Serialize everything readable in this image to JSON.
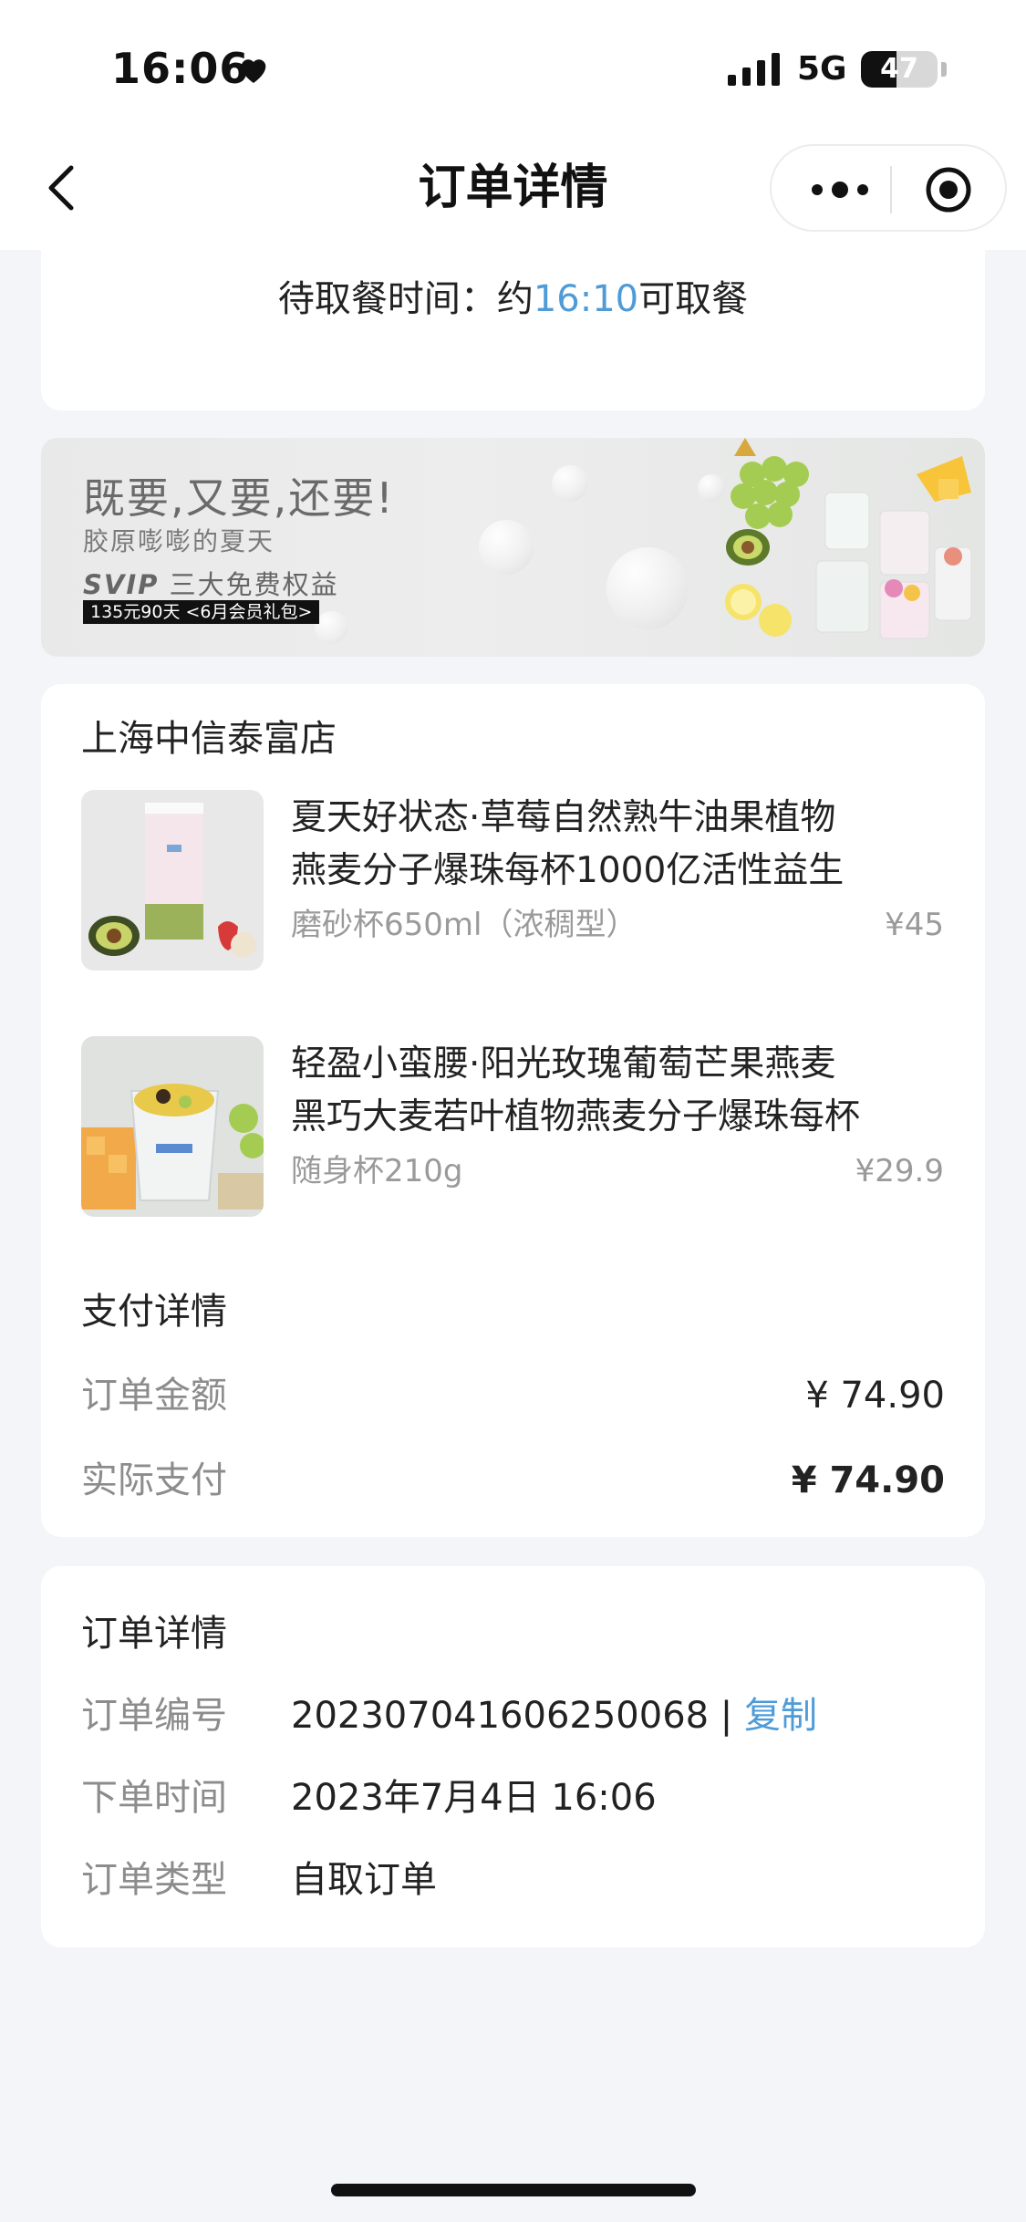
{
  "status_bar": {
    "time": "16:06",
    "network": "5G",
    "battery": "47",
    "battery_level": 0.47
  },
  "nav": {
    "title": "订单详情"
  },
  "pickup": {
    "prefix": "待取餐时间：约",
    "time": "16:10",
    "suffix": "可取餐"
  },
  "banner": {
    "headline": "既要,又要,还要!",
    "subline": "胶原嘭嘭的夏天",
    "svip": "SVIP",
    "benefit": "三大免费权益",
    "tag": "135元90天 <6月会员礼包>"
  },
  "order": {
    "store_name": "上海中信泰富店",
    "items": [
      {
        "title_line1": "夏天好状态·草莓自然熟牛油果植物",
        "title_line2": "燕麦分子爆珠每杯1000亿活性益生",
        "spec": "磨砂杯650ml（浓稠型）",
        "price": "¥45"
      },
      {
        "title_line1": "轻盈小蛮腰·阳光玫瑰葡萄芒果燕麦",
        "title_line2": "黑巧大麦若叶植物燕麦分子爆珠每杯",
        "spec": "随身杯210g",
        "price": "¥29.9"
      }
    ],
    "payment": {
      "title": "支付详情",
      "amount_label": "订单金额",
      "amount_value": "¥ 74.90",
      "paid_label": "实际支付",
      "paid_value": "¥ 74.90"
    }
  },
  "details": {
    "title": "订单详情",
    "number_label": "订单编号",
    "number_value": "202307041606250068",
    "separator": " | ",
    "copy_label": "复制",
    "time_label": "下单时间",
    "time_value": "2023年7月4日 16:06",
    "type_label": "订单类型",
    "type_value": "自取订单"
  },
  "colors": {
    "accent_blue": "#4e9bd8",
    "background": "#f4f5f9",
    "muted_text": "#8c8c8c"
  }
}
